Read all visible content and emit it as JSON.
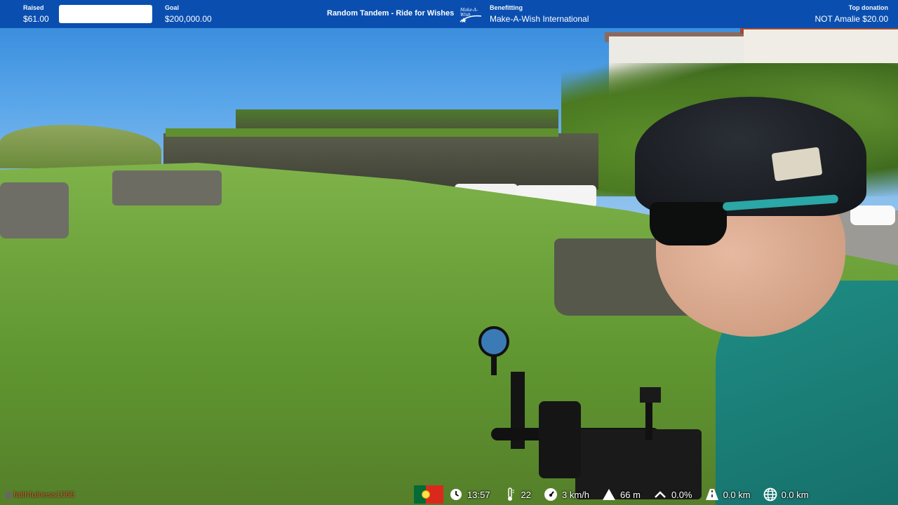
{
  "banner": {
    "raised_label": "Raised",
    "raised_value": "$61.00",
    "goal_label": "Goal",
    "goal_value": "$200,000.00",
    "progress_fraction": 0.0003,
    "title": "Random Tandem - Ride for Wishes",
    "logo_text": "Make-A-Wish",
    "benefiting_label": "Benefitting",
    "benefiting_value": "Make-A-Wish International",
    "top_donation_label": "Top donation",
    "top_donation_value": "NOT Amalie $20.00",
    "color": "#0a4fb0"
  },
  "chat": {
    "username": "faithfulness1066",
    "suffix": ":",
    "name_color": "#c7622c"
  },
  "hud": {
    "flag": "portugal-flag",
    "time": "13:57",
    "temperature": "22",
    "speed": "3 km/h",
    "altitude": "66 m",
    "grade": "0.0%",
    "segment_distance": "0.0 km",
    "total_distance": "0.0 km",
    "icons": [
      "clock-icon",
      "thermometer-icon",
      "speedometer-icon",
      "mountain-icon",
      "grade-icon",
      "road-icon",
      "globe-icon"
    ]
  }
}
